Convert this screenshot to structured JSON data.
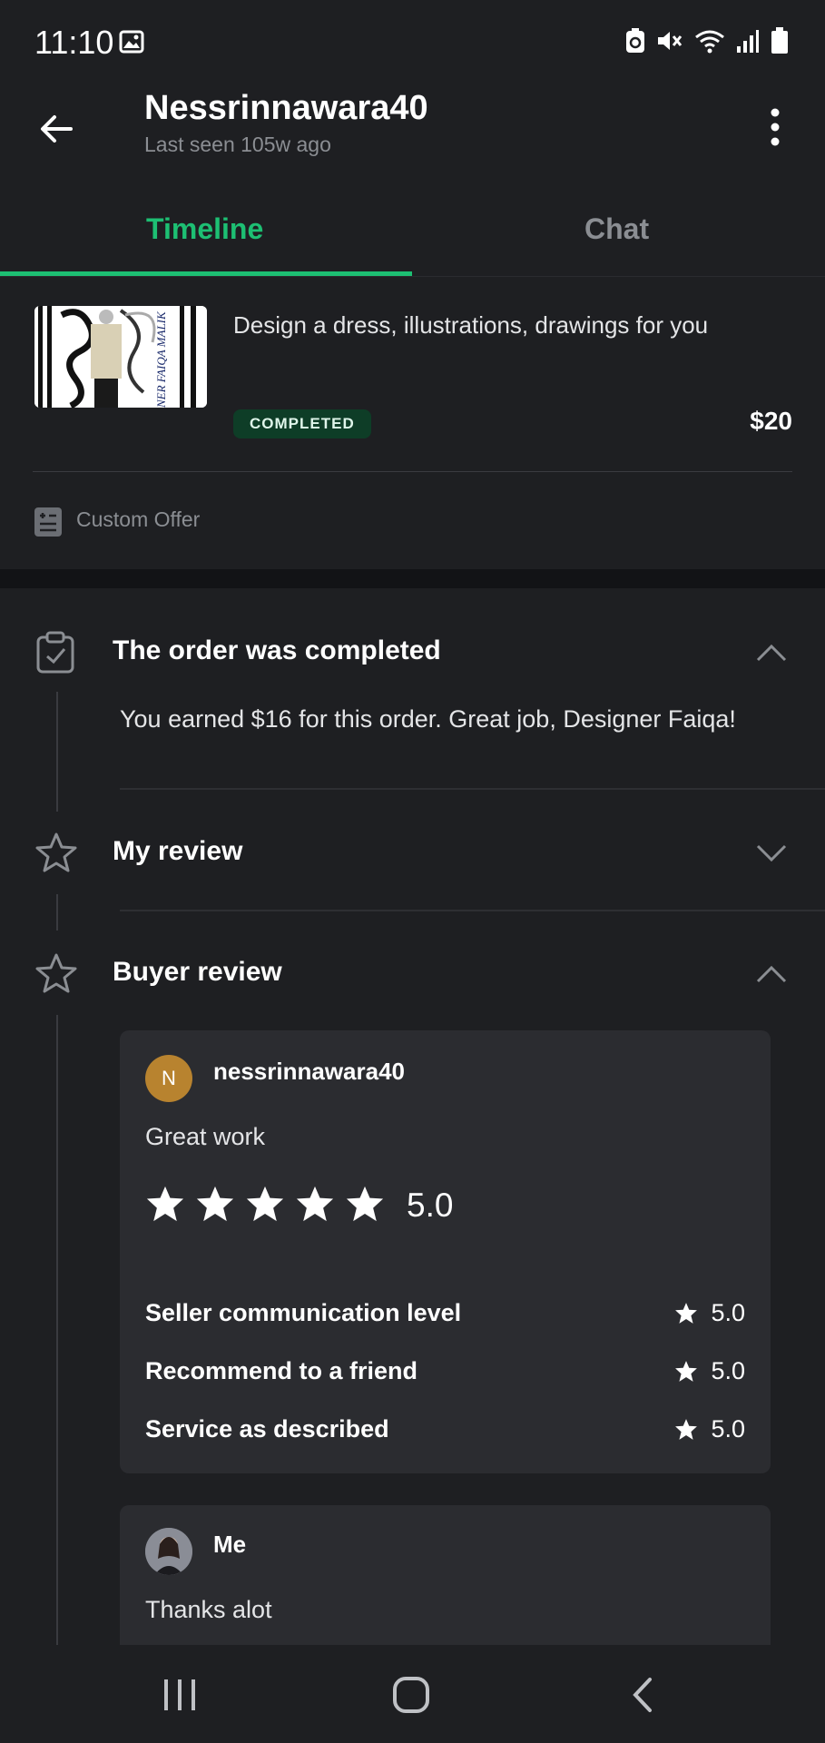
{
  "status_bar": {
    "time": "11:10"
  },
  "header": {
    "name": "Nessrinnawara40",
    "last_seen": "Last seen 105w ago"
  },
  "tabs": [
    {
      "label": "Timeline",
      "active": true
    },
    {
      "label": "Chat",
      "active": false
    }
  ],
  "order": {
    "title": "Design a dress, illustrations, drawings for you",
    "status": "COMPLETED",
    "price": "$20",
    "offer_type": "Custom Offer",
    "thumbnail_text": "NER FAIQA MALIK"
  },
  "timeline": {
    "completed": {
      "title": "The order was completed",
      "message": "You earned $16 for this order. Great job, Designer Faiqa!"
    },
    "my_review": {
      "title": "My review"
    },
    "buyer_review": {
      "title": "Buyer review",
      "reviewer_initial": "N",
      "reviewer": "nessrinnawara40",
      "text": "Great work",
      "stars": 5,
      "rating": "5.0",
      "criteria": [
        {
          "label": "Seller communication level",
          "value": "5.0"
        },
        {
          "label": "Recommend to a friend",
          "value": "5.0"
        },
        {
          "label": "Service as described",
          "value": "5.0"
        }
      ],
      "reply": {
        "author": "Me",
        "text": "Thanks alot"
      }
    }
  },
  "colors": {
    "accent": "#1dbf73",
    "background": "#1e1f22",
    "card": "#2b2c30",
    "badge_bg": "#0e3d27",
    "avatar": "#b8832f"
  }
}
